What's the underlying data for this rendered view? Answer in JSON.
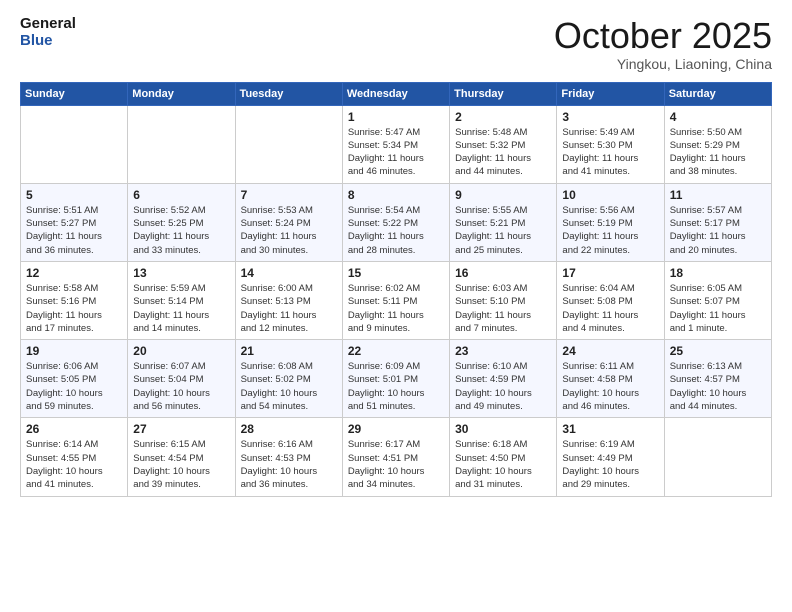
{
  "logo": {
    "line1": "General",
    "line2": "Blue"
  },
  "header": {
    "month": "October 2025",
    "location": "Yingkou, Liaoning, China"
  },
  "weekdays": [
    "Sunday",
    "Monday",
    "Tuesday",
    "Wednesday",
    "Thursday",
    "Friday",
    "Saturday"
  ],
  "weeks": [
    [
      {
        "day": "",
        "info": ""
      },
      {
        "day": "",
        "info": ""
      },
      {
        "day": "",
        "info": ""
      },
      {
        "day": "1",
        "info": "Sunrise: 5:47 AM\nSunset: 5:34 PM\nDaylight: 11 hours\nand 46 minutes."
      },
      {
        "day": "2",
        "info": "Sunrise: 5:48 AM\nSunset: 5:32 PM\nDaylight: 11 hours\nand 44 minutes."
      },
      {
        "day": "3",
        "info": "Sunrise: 5:49 AM\nSunset: 5:30 PM\nDaylight: 11 hours\nand 41 minutes."
      },
      {
        "day": "4",
        "info": "Sunrise: 5:50 AM\nSunset: 5:29 PM\nDaylight: 11 hours\nand 38 minutes."
      }
    ],
    [
      {
        "day": "5",
        "info": "Sunrise: 5:51 AM\nSunset: 5:27 PM\nDaylight: 11 hours\nand 36 minutes."
      },
      {
        "day": "6",
        "info": "Sunrise: 5:52 AM\nSunset: 5:25 PM\nDaylight: 11 hours\nand 33 minutes."
      },
      {
        "day": "7",
        "info": "Sunrise: 5:53 AM\nSunset: 5:24 PM\nDaylight: 11 hours\nand 30 minutes."
      },
      {
        "day": "8",
        "info": "Sunrise: 5:54 AM\nSunset: 5:22 PM\nDaylight: 11 hours\nand 28 minutes."
      },
      {
        "day": "9",
        "info": "Sunrise: 5:55 AM\nSunset: 5:21 PM\nDaylight: 11 hours\nand 25 minutes."
      },
      {
        "day": "10",
        "info": "Sunrise: 5:56 AM\nSunset: 5:19 PM\nDaylight: 11 hours\nand 22 minutes."
      },
      {
        "day": "11",
        "info": "Sunrise: 5:57 AM\nSunset: 5:17 PM\nDaylight: 11 hours\nand 20 minutes."
      }
    ],
    [
      {
        "day": "12",
        "info": "Sunrise: 5:58 AM\nSunset: 5:16 PM\nDaylight: 11 hours\nand 17 minutes."
      },
      {
        "day": "13",
        "info": "Sunrise: 5:59 AM\nSunset: 5:14 PM\nDaylight: 11 hours\nand 14 minutes."
      },
      {
        "day": "14",
        "info": "Sunrise: 6:00 AM\nSunset: 5:13 PM\nDaylight: 11 hours\nand 12 minutes."
      },
      {
        "day": "15",
        "info": "Sunrise: 6:02 AM\nSunset: 5:11 PM\nDaylight: 11 hours\nand 9 minutes."
      },
      {
        "day": "16",
        "info": "Sunrise: 6:03 AM\nSunset: 5:10 PM\nDaylight: 11 hours\nand 7 minutes."
      },
      {
        "day": "17",
        "info": "Sunrise: 6:04 AM\nSunset: 5:08 PM\nDaylight: 11 hours\nand 4 minutes."
      },
      {
        "day": "18",
        "info": "Sunrise: 6:05 AM\nSunset: 5:07 PM\nDaylight: 11 hours\nand 1 minute."
      }
    ],
    [
      {
        "day": "19",
        "info": "Sunrise: 6:06 AM\nSunset: 5:05 PM\nDaylight: 10 hours\nand 59 minutes."
      },
      {
        "day": "20",
        "info": "Sunrise: 6:07 AM\nSunset: 5:04 PM\nDaylight: 10 hours\nand 56 minutes."
      },
      {
        "day": "21",
        "info": "Sunrise: 6:08 AM\nSunset: 5:02 PM\nDaylight: 10 hours\nand 54 minutes."
      },
      {
        "day": "22",
        "info": "Sunrise: 6:09 AM\nSunset: 5:01 PM\nDaylight: 10 hours\nand 51 minutes."
      },
      {
        "day": "23",
        "info": "Sunrise: 6:10 AM\nSunset: 4:59 PM\nDaylight: 10 hours\nand 49 minutes."
      },
      {
        "day": "24",
        "info": "Sunrise: 6:11 AM\nSunset: 4:58 PM\nDaylight: 10 hours\nand 46 minutes."
      },
      {
        "day": "25",
        "info": "Sunrise: 6:13 AM\nSunset: 4:57 PM\nDaylight: 10 hours\nand 44 minutes."
      }
    ],
    [
      {
        "day": "26",
        "info": "Sunrise: 6:14 AM\nSunset: 4:55 PM\nDaylight: 10 hours\nand 41 minutes."
      },
      {
        "day": "27",
        "info": "Sunrise: 6:15 AM\nSunset: 4:54 PM\nDaylight: 10 hours\nand 39 minutes."
      },
      {
        "day": "28",
        "info": "Sunrise: 6:16 AM\nSunset: 4:53 PM\nDaylight: 10 hours\nand 36 minutes."
      },
      {
        "day": "29",
        "info": "Sunrise: 6:17 AM\nSunset: 4:51 PM\nDaylight: 10 hours\nand 34 minutes."
      },
      {
        "day": "30",
        "info": "Sunrise: 6:18 AM\nSunset: 4:50 PM\nDaylight: 10 hours\nand 31 minutes."
      },
      {
        "day": "31",
        "info": "Sunrise: 6:19 AM\nSunset: 4:49 PM\nDaylight: 10 hours\nand 29 minutes."
      },
      {
        "day": "",
        "info": ""
      }
    ]
  ]
}
